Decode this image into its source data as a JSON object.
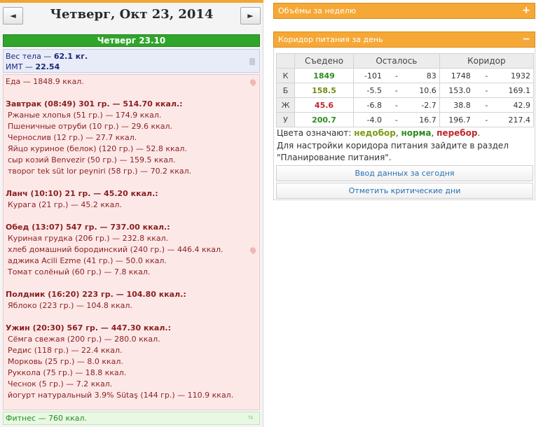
{
  "nav": {
    "prev": "◄",
    "next": "►",
    "title": "Четверг, Окт 23, 2014"
  },
  "day": {
    "header": "Четверг 23.10"
  },
  "weight": {
    "label": "Вес тела — ",
    "value": "62.1 кг.",
    "bmi_label": "ИМТ — ",
    "bmi_value": "22.54"
  },
  "food": {
    "total": "Еда — 1848.9 ккал.",
    "meals": [
      {
        "title": "Завтрак (08:49) 301 гр. — 514.70 ккал.:",
        "items": [
          "Ржаные хлопья (51 гр.) — 174.9 ккал.",
          "Пшеничные отруби (10 гр.) — 29.6 ккал.",
          "Чернослив (12 гр.) — 27.7 ккал.",
          "Яйцо куриное (белок) (120 гр.) — 52.8 ккал.",
          "сыр козий Benvezir (50 гр.) — 159.5 ккал.",
          "творог tek süt lor peyniri (58 гр.) — 70.2 ккал."
        ]
      },
      {
        "title": "Ланч (10:10) 21 гр. — 45.20 ккал.:",
        "items": [
          "Курага (21 гр.) — 45.2 ккал."
        ]
      },
      {
        "title": "Обед (13:07) 547 гр. — 737.00 ккал.:",
        "items": [
          "Куриная грудка (206 гр.) — 232.8 ккал.",
          "хлеб домашний бородинский (240 гр.) — 446.4 ккал.",
          "аджика Acili Ezme (41 гр.) — 50.0 ккал.",
          "Томат солёный (60 гр.) — 7.8 ккал."
        ]
      },
      {
        "title": "Полдник (16:20) 223 гр. — 104.80 ккал.:",
        "items": [
          "Яблоко (223 гр.) — 104.8 ккал."
        ]
      },
      {
        "title": "Ужин (20:30) 567 гр. — 447.30 ккал.:",
        "items": [
          "Сёмга свежая (200 гр.) — 280.0 ккал.",
          "Редис (118 гр.) — 22.4 ккал.",
          "Морковь (25 гр.) — 8.0 ккал.",
          "Руккола (75 гр.) — 18.8 ккал.",
          "Чеснок (5 гр.) — 7.2 ккал.",
          "йогурт натуральный 3.9% Sütaş (144 гр.) — 110.9 ккал."
        ]
      }
    ]
  },
  "fitness": {
    "label": "Фитнес — 760 ккал."
  },
  "panels": {
    "weekly": {
      "title": "Объёмы за неделю",
      "sign": "+"
    },
    "corridor": {
      "title": "Коридор питания за день",
      "sign": "−"
    }
  },
  "table": {
    "headers": [
      "Съедено",
      "Осталось",
      "Коридор"
    ],
    "rows": [
      {
        "label": "К",
        "eaten": "1849",
        "eaten_color": "green",
        "rem_min": "-101",
        "rem_max": "83",
        "cor_min": "1748",
        "cor_max": "1932"
      },
      {
        "label": "Б",
        "eaten": "158.5",
        "eaten_color": "olive",
        "rem_min": "-5.5",
        "rem_max": "10.6",
        "cor_min": "153.0",
        "cor_max": "169.1"
      },
      {
        "label": "Ж",
        "eaten": "45.6",
        "eaten_color": "red",
        "rem_min": "-6.8",
        "rem_max": "-2.7",
        "cor_min": "38.8",
        "cor_max": "42.9"
      },
      {
        "label": "У",
        "eaten": "200.7",
        "eaten_color": "green",
        "rem_min": "-4.0",
        "rem_max": "16.7",
        "cor_min": "196.7",
        "cor_max": "217.4"
      }
    ],
    "dash": "-"
  },
  "legend": {
    "prefix": "Цвета означают: ",
    "under": "недобор",
    "sep1": ", ",
    "norm": "норма",
    "sep2": ", ",
    "over": "перебор",
    "end": "."
  },
  "hint": "Для настройки коридора питания зайдите в раздел \"Планирование питания\".",
  "buttons": {
    "enter_today": "Ввод данных за сегодня",
    "mark_critical": "Отметить критические дни"
  },
  "colors": {
    "accent": "#f6a836",
    "green_header": "#2fa52b"
  }
}
